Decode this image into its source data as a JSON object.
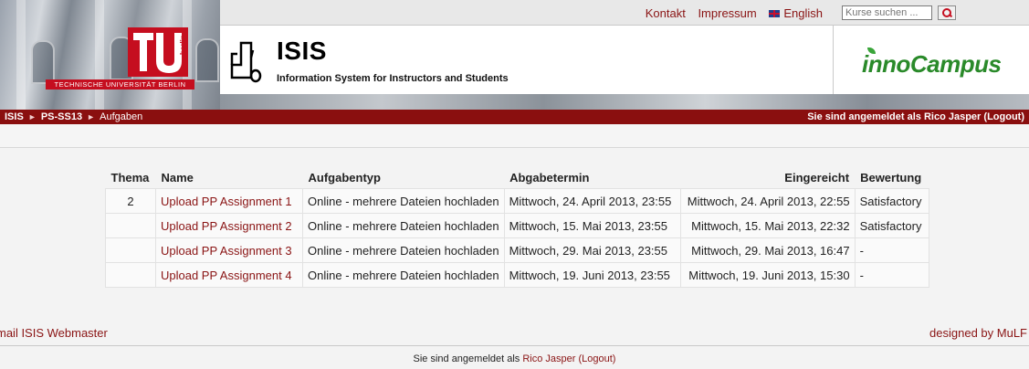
{
  "header": {
    "tu_caption": "TECHNISCHE UNIVERSITÄT BERLIN",
    "tu_mark_text": "berlin",
    "top_links": {
      "kontakt": "Kontakt",
      "impressum": "Impressum",
      "english": "English"
    },
    "search": {
      "placeholder": "Kurse suchen ..."
    },
    "isis_title": "ISIS",
    "isis_subtitle": "Information System for Instructors and Students",
    "partner_logo": "innoCampus",
    "icons": [
      "search-icon",
      "uk-flag-icon",
      "isis-logo-icon",
      "tu-berlin-logo"
    ],
    "colors": {
      "brand_red": "#c50e1f",
      "navbar": "#8a0f0f",
      "link": "#8a1414",
      "inno_green": "#2a8a2a"
    }
  },
  "navbar": {
    "breadcrumb": [
      "ISIS",
      "PS-SS13",
      "Aufgaben"
    ],
    "separator": "►",
    "login_prefix": "Sie sind angemeldet als",
    "user": "Rico Jasper",
    "logout": "(Logout)"
  },
  "table": {
    "headers": [
      "Thema",
      "Name",
      "Aufgabentyp",
      "Abgabetermin",
      "Eingereicht",
      "Bewertung"
    ],
    "rows": [
      {
        "thema": "2",
        "name": "Upload PP Assignment 1",
        "type": "Online - mehrere Dateien hochladen",
        "due": "Mittwoch, 24. April 2013, 23:55",
        "submitted": "Mittwoch, 24. April 2013, 22:55",
        "grade": "Satisfactory"
      },
      {
        "thema": "",
        "name": "Upload PP Assignment 2",
        "type": "Online - mehrere Dateien hochladen",
        "due": "Mittwoch, 15. Mai 2013, 23:55",
        "submitted": "Mittwoch, 15. Mai 2013, 22:32",
        "grade": "Satisfactory"
      },
      {
        "thema": "",
        "name": "Upload PP Assignment 3",
        "type": "Online - mehrere Dateien hochladen",
        "due": "Mittwoch, 29. Mai 2013, 23:55",
        "submitted": "Mittwoch, 29. Mai 2013, 16:47",
        "grade": "-"
      },
      {
        "thema": "",
        "name": "Upload PP Assignment 4",
        "type": "Online - mehrere Dateien hochladen",
        "due": "Mittwoch, 19. Juni 2013, 23:55",
        "submitted": "Mittwoch, 19. Juni 2013, 15:30",
        "grade": "-"
      }
    ]
  },
  "footer": {
    "webmaster": "mail ISIS Webmaster",
    "designed_by": "designed by MuLF",
    "login_prefix": "Sie sind angemeldet als",
    "user": "Rico Jasper",
    "logout": "(Logout)"
  }
}
